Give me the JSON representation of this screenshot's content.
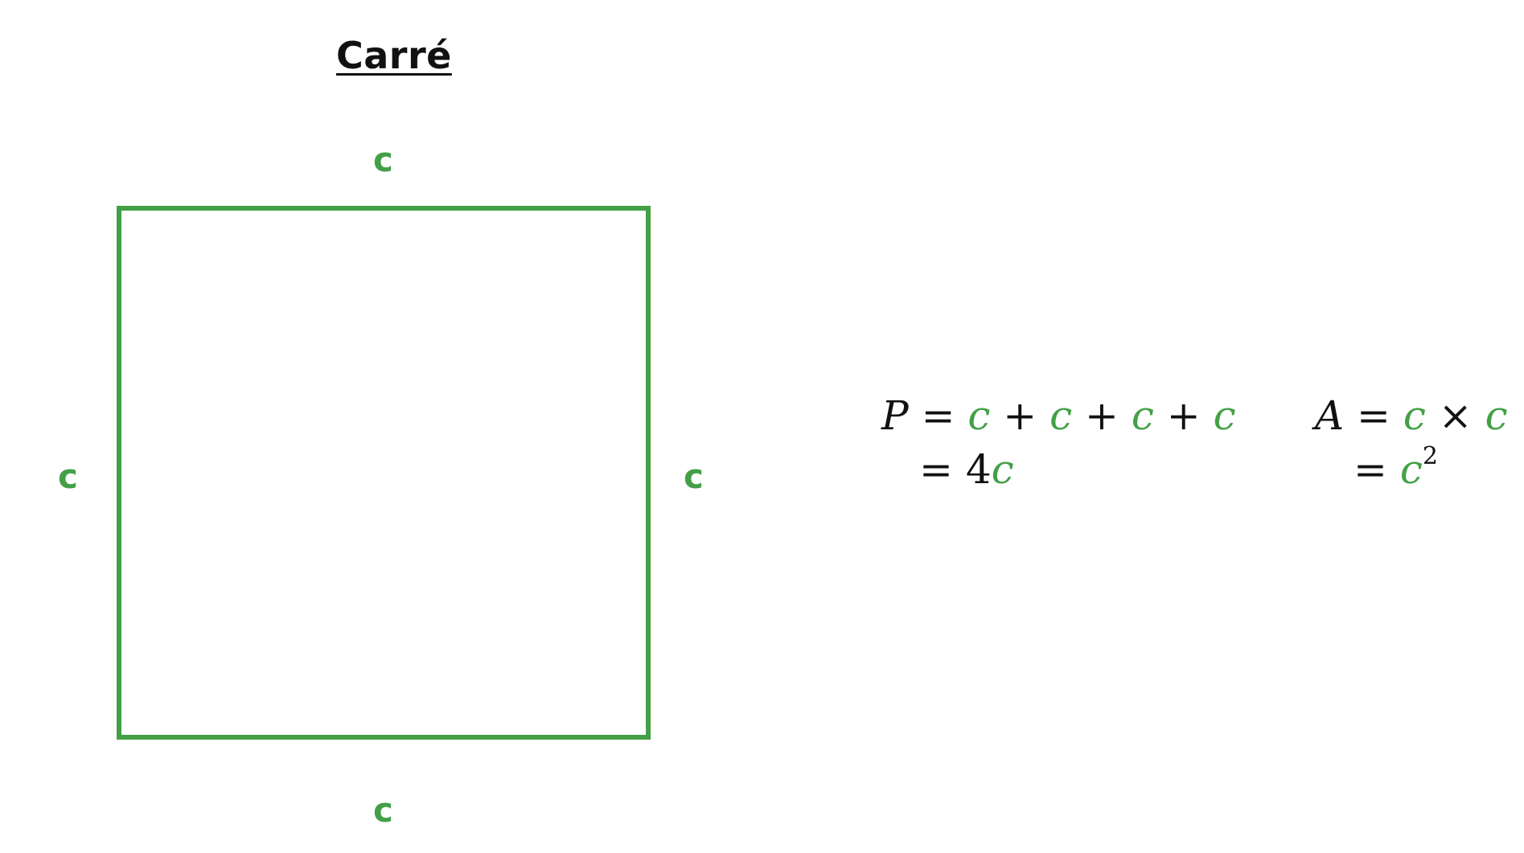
{
  "title": "Carré",
  "colors": {
    "accent": "#43a047",
    "text": "#111111"
  },
  "square": {
    "side_label": "c"
  },
  "perimeter": {
    "symbol": "P",
    "line1": {
      "eq": "=",
      "terms": [
        "c",
        "c",
        "c",
        "c"
      ],
      "op": "+"
    },
    "line2": {
      "eq": "=",
      "coef": "4",
      "var": "c"
    }
  },
  "area": {
    "symbol": "A",
    "line1": {
      "eq": "=",
      "terms": [
        "c",
        "c"
      ],
      "op": "×"
    },
    "line2": {
      "eq": "=",
      "var": "c",
      "exp": "2"
    }
  }
}
